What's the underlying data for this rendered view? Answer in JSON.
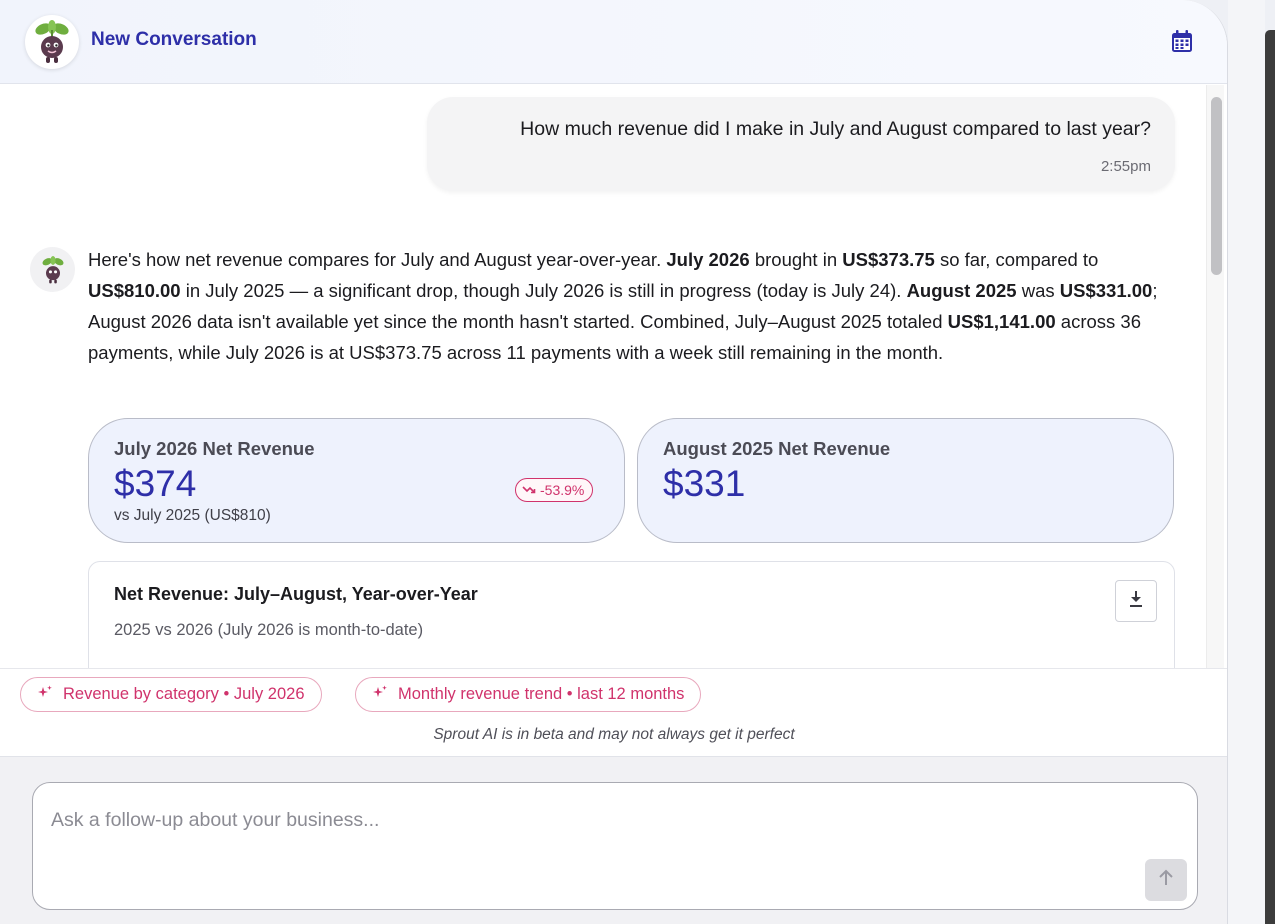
{
  "header": {
    "title": "New Conversation",
    "avatar_icon": "sprout-mascot-icon",
    "calendar_icon": "calendar-icon"
  },
  "user_message": {
    "text": "How much revenue did I make in July and August compared to last year?",
    "time": "2:55pm"
  },
  "ai_message": {
    "segments": [
      {
        "t": "Here's how net revenue compares for July and August year-over-year. ",
        "b": false
      },
      {
        "t": "July 2026",
        "b": true
      },
      {
        "t": " brought in ",
        "b": false
      },
      {
        "t": "US$373.75",
        "b": true
      },
      {
        "t": " so far, compared to ",
        "b": false
      },
      {
        "t": "US$810.00",
        "b": true
      },
      {
        "t": " in July 2025 — a significant drop, though July 2026 is still in progress (today is July 24). ",
        "b": false
      },
      {
        "t": "August 2025",
        "b": true
      },
      {
        "t": " was ",
        "b": false
      },
      {
        "t": "US$331.00",
        "b": true
      },
      {
        "t": "; August 2026 data isn't available yet since the month hasn't started. Combined, July–August 2025 totaled ",
        "b": false
      },
      {
        "t": "US$1,141.00",
        "b": true
      },
      {
        "t": " across 36 payments, while July 2026 is at US$373.75 across 11 payments with a week still remaining in the month.",
        "b": false
      }
    ]
  },
  "metrics": [
    {
      "label": "July 2026 Net Revenue",
      "value": "$374",
      "sub": "vs July 2025 (US$810)",
      "change": "-53.9%",
      "change_icon": "trend-down-icon"
    },
    {
      "label": "August 2025 Net Revenue",
      "value": "$331"
    }
  ],
  "chart_card": {
    "title": "Net Revenue: July–August, Year-over-Year",
    "subtitle": "2025 vs 2026 (July 2026 is month-to-date)",
    "download_icon": "download-icon"
  },
  "suggestions": [
    {
      "label": "Revenue by category • July 2026",
      "icon": "sparkle-icon"
    },
    {
      "label": "Monthly revenue trend • last 12 months",
      "icon": "sparkle-icon"
    }
  ],
  "beta_note": "Sprout AI is in beta and may not always get it perfect",
  "composer": {
    "placeholder": "Ask a follow-up about your business...",
    "value": "",
    "send_icon": "arrow-up-icon"
  },
  "colors": {
    "accent": "#2e2fa8",
    "negative": "#d0336c",
    "card_bg": "#eef2fd"
  }
}
